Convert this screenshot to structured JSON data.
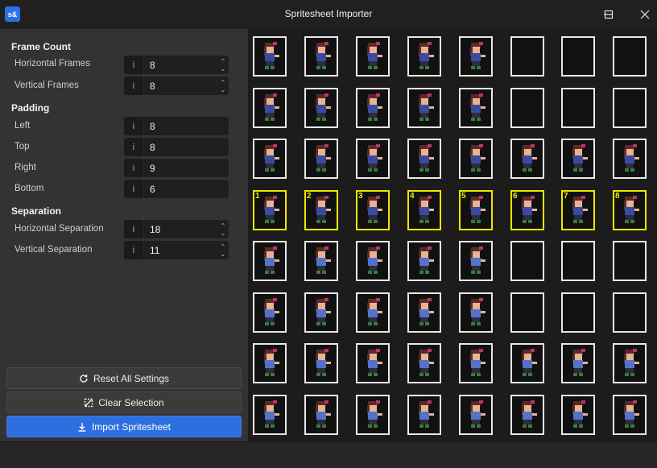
{
  "window": {
    "title": "Spritesheet Importer",
    "app_icon_text": "s&"
  },
  "settings": {
    "frame_count": {
      "heading": "Frame Count",
      "horizontal_label": "Horizontal Frames",
      "horizontal_value": "8",
      "vertical_label": "Vertical Frames",
      "vertical_value": "8"
    },
    "padding": {
      "heading": "Padding",
      "left_label": "Left",
      "left_value": "8",
      "top_label": "Top",
      "top_value": "8",
      "right_label": "Right",
      "right_value": "9",
      "bottom_label": "Bottom",
      "bottom_value": "6"
    },
    "separation": {
      "heading": "Separation",
      "horizontal_label": "Horizontal Separation",
      "horizontal_value": "18",
      "vertical_label": "Vertical Separation",
      "vertical_value": "11"
    },
    "field_icon": "i"
  },
  "actions": {
    "reset_label": "Reset All Settings",
    "clear_label": "Clear Selection",
    "import_label": "Import Spritesheet"
  },
  "grid": {
    "columns": 8,
    "rows": 8,
    "filled_per_row": [
      5,
      5,
      8,
      8,
      5,
      5,
      8,
      8
    ],
    "selected_row": 4,
    "selected_numbers": [
      "1",
      "2",
      "3",
      "4",
      "5",
      "6",
      "7",
      "8"
    ]
  },
  "colors": {
    "accent": "#2e6fe0",
    "selection": "#f2e600",
    "cell_border": "#e8e8e8"
  }
}
